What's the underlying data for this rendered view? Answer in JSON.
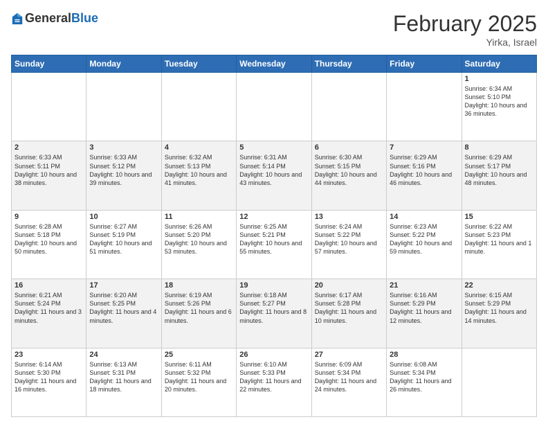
{
  "header": {
    "logo": {
      "general": "General",
      "blue": "Blue"
    },
    "title": "February 2025",
    "location": "Yirka, Israel"
  },
  "days_of_week": [
    "Sunday",
    "Monday",
    "Tuesday",
    "Wednesday",
    "Thursday",
    "Friday",
    "Saturday"
  ],
  "weeks": [
    [
      {
        "day": null,
        "info": null
      },
      {
        "day": null,
        "info": null
      },
      {
        "day": null,
        "info": null
      },
      {
        "day": null,
        "info": null
      },
      {
        "day": null,
        "info": null
      },
      {
        "day": null,
        "info": null
      },
      {
        "day": "1",
        "info": "Sunrise: 6:34 AM\nSunset: 5:10 PM\nDaylight: 10 hours and 36 minutes."
      }
    ],
    [
      {
        "day": "2",
        "info": "Sunrise: 6:33 AM\nSunset: 5:11 PM\nDaylight: 10 hours and 38 minutes."
      },
      {
        "day": "3",
        "info": "Sunrise: 6:33 AM\nSunset: 5:12 PM\nDaylight: 10 hours and 39 minutes."
      },
      {
        "day": "4",
        "info": "Sunrise: 6:32 AM\nSunset: 5:13 PM\nDaylight: 10 hours and 41 minutes."
      },
      {
        "day": "5",
        "info": "Sunrise: 6:31 AM\nSunset: 5:14 PM\nDaylight: 10 hours and 43 minutes."
      },
      {
        "day": "6",
        "info": "Sunrise: 6:30 AM\nSunset: 5:15 PM\nDaylight: 10 hours and 44 minutes."
      },
      {
        "day": "7",
        "info": "Sunrise: 6:29 AM\nSunset: 5:16 PM\nDaylight: 10 hours and 46 minutes."
      },
      {
        "day": "8",
        "info": "Sunrise: 6:29 AM\nSunset: 5:17 PM\nDaylight: 10 hours and 48 minutes."
      }
    ],
    [
      {
        "day": "9",
        "info": "Sunrise: 6:28 AM\nSunset: 5:18 PM\nDaylight: 10 hours and 50 minutes."
      },
      {
        "day": "10",
        "info": "Sunrise: 6:27 AM\nSunset: 5:19 PM\nDaylight: 10 hours and 51 minutes."
      },
      {
        "day": "11",
        "info": "Sunrise: 6:26 AM\nSunset: 5:20 PM\nDaylight: 10 hours and 53 minutes."
      },
      {
        "day": "12",
        "info": "Sunrise: 6:25 AM\nSunset: 5:21 PM\nDaylight: 10 hours and 55 minutes."
      },
      {
        "day": "13",
        "info": "Sunrise: 6:24 AM\nSunset: 5:22 PM\nDaylight: 10 hours and 57 minutes."
      },
      {
        "day": "14",
        "info": "Sunrise: 6:23 AM\nSunset: 5:22 PM\nDaylight: 10 hours and 59 minutes."
      },
      {
        "day": "15",
        "info": "Sunrise: 6:22 AM\nSunset: 5:23 PM\nDaylight: 11 hours and 1 minute."
      }
    ],
    [
      {
        "day": "16",
        "info": "Sunrise: 6:21 AM\nSunset: 5:24 PM\nDaylight: 11 hours and 3 minutes."
      },
      {
        "day": "17",
        "info": "Sunrise: 6:20 AM\nSunset: 5:25 PM\nDaylight: 11 hours and 4 minutes."
      },
      {
        "day": "18",
        "info": "Sunrise: 6:19 AM\nSunset: 5:26 PM\nDaylight: 11 hours and 6 minutes."
      },
      {
        "day": "19",
        "info": "Sunrise: 6:18 AM\nSunset: 5:27 PM\nDaylight: 11 hours and 8 minutes."
      },
      {
        "day": "20",
        "info": "Sunrise: 6:17 AM\nSunset: 5:28 PM\nDaylight: 11 hours and 10 minutes."
      },
      {
        "day": "21",
        "info": "Sunrise: 6:16 AM\nSunset: 5:29 PM\nDaylight: 11 hours and 12 minutes."
      },
      {
        "day": "22",
        "info": "Sunrise: 6:15 AM\nSunset: 5:29 PM\nDaylight: 11 hours and 14 minutes."
      }
    ],
    [
      {
        "day": "23",
        "info": "Sunrise: 6:14 AM\nSunset: 5:30 PM\nDaylight: 11 hours and 16 minutes."
      },
      {
        "day": "24",
        "info": "Sunrise: 6:13 AM\nSunset: 5:31 PM\nDaylight: 11 hours and 18 minutes."
      },
      {
        "day": "25",
        "info": "Sunrise: 6:11 AM\nSunset: 5:32 PM\nDaylight: 11 hours and 20 minutes."
      },
      {
        "day": "26",
        "info": "Sunrise: 6:10 AM\nSunset: 5:33 PM\nDaylight: 11 hours and 22 minutes."
      },
      {
        "day": "27",
        "info": "Sunrise: 6:09 AM\nSunset: 5:34 PM\nDaylight: 11 hours and 24 minutes."
      },
      {
        "day": "28",
        "info": "Sunrise: 6:08 AM\nSunset: 5:34 PM\nDaylight: 11 hours and 26 minutes."
      },
      {
        "day": null,
        "info": null
      }
    ]
  ]
}
